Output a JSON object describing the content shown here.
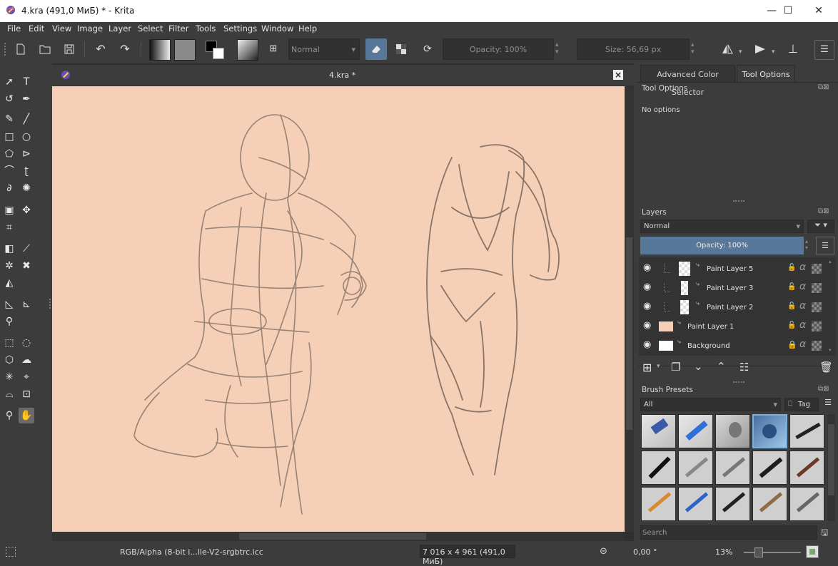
{
  "window": {
    "title": "4.kra (491,0 МиБ)  * - Krita",
    "controls": {
      "minimize": "—",
      "maximize": "☐",
      "close": "✕"
    }
  },
  "menu": [
    "File",
    "Edit",
    "View",
    "Image",
    "Layer",
    "Select",
    "Filter",
    "Tools",
    "Settings",
    "Window",
    "Help"
  ],
  "toolbar": {
    "blend_mode": "Normal",
    "opacity": "Opacity: 100%",
    "size": "Size: 56,69 px"
  },
  "document": {
    "tab_title": "4.kra *",
    "close": "×"
  },
  "docker": {
    "tabs": [
      "Advanced Color Selector",
      "Tool Options"
    ],
    "active_tab": "Tool Options",
    "tool_options": {
      "header": "Tool Options",
      "message": "No options"
    },
    "layers": {
      "header": "Layers",
      "blend_mode": "Normal",
      "opacity": "Opacity:  100%",
      "items": [
        {
          "name": "Paint Layer 5",
          "thumb": "checker",
          "indent": true,
          "locked": false
        },
        {
          "name": "Paint Layer 3",
          "thumb": "checker",
          "indent": true,
          "locked": false
        },
        {
          "name": "Paint Layer 2",
          "thumb": "checker",
          "indent": true,
          "locked": false
        },
        {
          "name": "Paint Layer 1",
          "thumb": "#f5cfb6",
          "indent": false,
          "locked": false
        },
        {
          "name": "Background",
          "thumb": "#ffffff",
          "indent": false,
          "locked": true
        }
      ]
    },
    "brush_presets": {
      "header": "Brush Presets",
      "filter": "All",
      "tag": "Tag",
      "search_placeholder": "Search"
    }
  },
  "status": {
    "color_space": "RGB/Alpha (8-bit i...lle-V2-srgbtrc.icc",
    "dimensions": "7 016 x 4 961 (491,0 МиБ)",
    "rotation": "0,00 °",
    "zoom": "13%"
  },
  "colors": {
    "accent": "#58789a",
    "canvas": "#f5cfb6",
    "panel": "#3c3c3c"
  }
}
